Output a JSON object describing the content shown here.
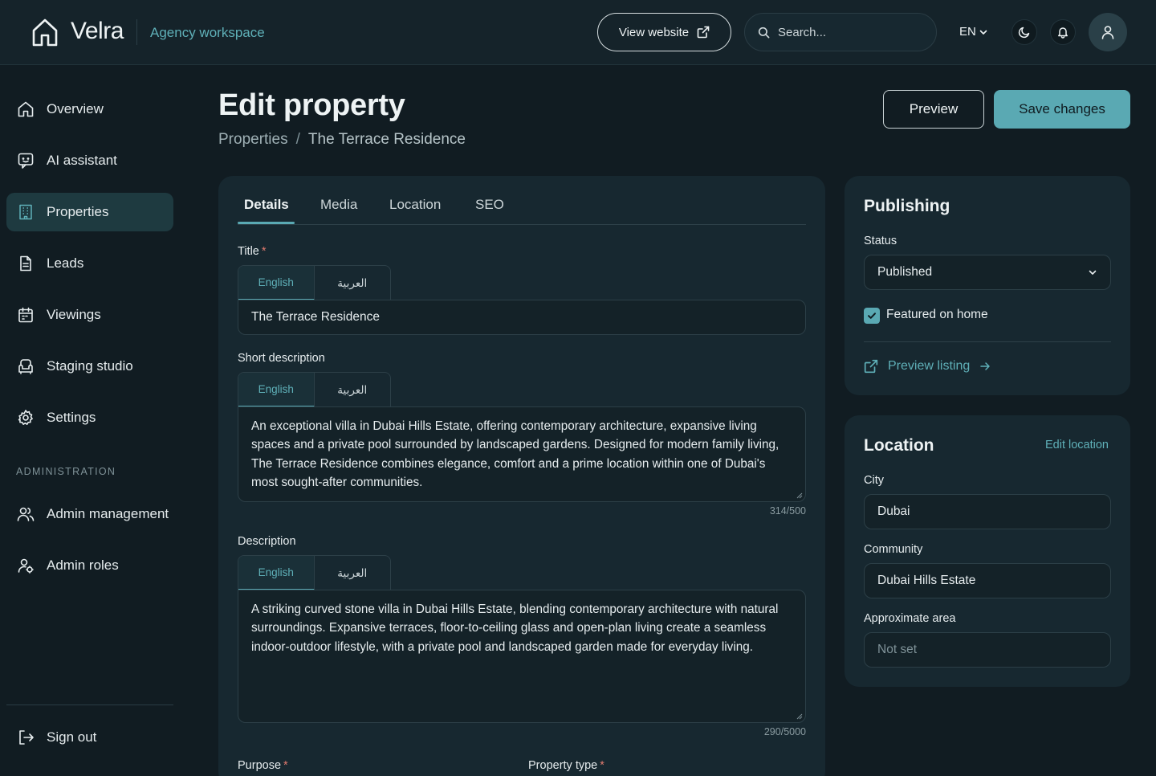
{
  "brand": {
    "name": "Velra",
    "workspace": "Agency workspace"
  },
  "topbar": {
    "view_website": "View website",
    "search_placeholder": "Search...",
    "language": "EN"
  },
  "sidebar": {
    "items": [
      {
        "label": "Overview",
        "icon": "home-icon"
      },
      {
        "label": "AI assistant",
        "icon": "chat-bot-icon"
      },
      {
        "label": "Properties",
        "icon": "building-icon",
        "active": true
      },
      {
        "label": "Leads",
        "icon": "document-icon"
      },
      {
        "label": "Viewings",
        "icon": "calendar-icon"
      },
      {
        "label": "Staging studio",
        "icon": "armchair-icon"
      },
      {
        "label": "Settings",
        "icon": "gear-icon"
      }
    ],
    "admin_section_label": "ADMINISTRATION",
    "admin_items": [
      {
        "label": "Admin management",
        "icon": "users-icon"
      },
      {
        "label": "Admin roles",
        "icon": "user-role-icon"
      }
    ],
    "sign_out": "Sign out"
  },
  "page": {
    "title": "Edit property",
    "breadcrumb": {
      "parent": "Properties",
      "separator": "/",
      "current": "The Terrace Residence"
    },
    "preview_button": "Preview",
    "save_button": "Save changes"
  },
  "form": {
    "tabs": [
      "Details",
      "Media",
      "Location",
      "SEO"
    ],
    "active_tab": "Details",
    "lang_tabs": {
      "english": "English",
      "arabic": "العربية"
    },
    "title": {
      "label": "Title",
      "required_mark": "*",
      "value": "The Terrace Residence"
    },
    "short_description": {
      "label": "Short description",
      "value": "An exceptional villa in Dubai Hills Estate, offering contemporary architecture, expansive living spaces and a private pool surrounded by landscaped gardens. Designed for modern family living, The Terrace Residence combines elegance, comfort and a prime location within one of Dubai's most sought-after communities.",
      "counter": "314/500"
    },
    "description": {
      "label": "Description",
      "value": "A striking curved stone villa in Dubai Hills Estate, blending contemporary architecture with natural surroundings. Expansive terraces, floor-to-ceiling glass and open-plan living create a seamless indoor-outdoor lifestyle, with a private pool and landscaped garden made for everyday living.",
      "counter": "290/5000"
    },
    "purpose_label": "Purpose",
    "property_type_label": "Property type"
  },
  "publishing": {
    "title": "Publishing",
    "status_label": "Status",
    "status_value": "Published",
    "featured_label": "Featured on home",
    "featured_checked": true,
    "preview_listing": "Preview listing"
  },
  "location_card": {
    "title": "Location",
    "edit_link": "Edit location",
    "city_label": "City",
    "city_value": "Dubai",
    "community_label": "Community",
    "community_value": "Dubai Hills Estate",
    "area_label": "Approximate area",
    "area_placeholder": "Not set"
  },
  "colors": {
    "background": "#111c22",
    "card": "#172830",
    "accent": "#5aa9b3",
    "active_nav": "#1e3a40",
    "required": "#e07a6e"
  }
}
